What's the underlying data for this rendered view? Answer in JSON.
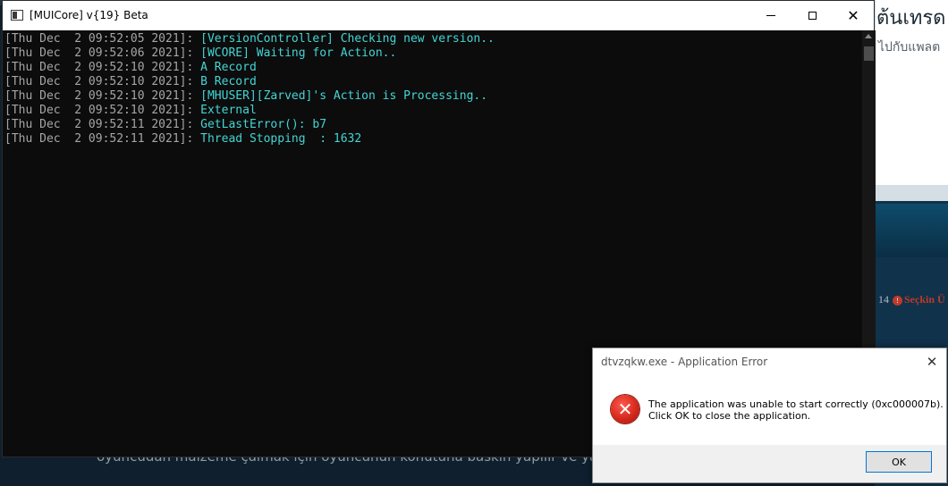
{
  "background": {
    "headline": "ต้นเทรด",
    "subline": "ไปกับแพลต",
    "stat_number": "14",
    "stat_label": "Seçkin Ü",
    "bottom_text": "oyuncudan malzeme çalmak için oyuncunun konutuna baskın yapılır ve yağmal"
  },
  "console": {
    "title": "[MUICore] v{19} Beta",
    "lines": [
      {
        "ts": "[Thu Dec  2 09:52:05 2021]: ",
        "msg": "[VersionController] Checking new version.."
      },
      {
        "ts": "[Thu Dec  2 09:52:06 2021]: ",
        "msg": "[WCORE] Waiting for Action.."
      },
      {
        "ts": "[Thu Dec  2 09:52:10 2021]: ",
        "msg": "A Record"
      },
      {
        "ts": "[Thu Dec  2 09:52:10 2021]: ",
        "msg": "B Record"
      },
      {
        "ts": "[Thu Dec  2 09:52:10 2021]: ",
        "msg": "[MHUSER][Zarved]'s Action is Processing.."
      },
      {
        "ts": "[Thu Dec  2 09:52:10 2021]: ",
        "msg": "External"
      },
      {
        "ts": "[Thu Dec  2 09:52:11 2021]: ",
        "msg": "GetLastError(): b7"
      },
      {
        "ts": "[Thu Dec  2 09:52:11 2021]: ",
        "msg": "Thread Stopping  : 1632"
      }
    ]
  },
  "dialog": {
    "title": "dtvzqkw.exe - Application Error",
    "message_line1": "The application was unable to start correctly (0xc000007b).",
    "message_line2": "Click OK to close the application.",
    "ok_label": "OK"
  },
  "icons": {
    "console_app": "console-window-icon",
    "minimize": "minimize-icon",
    "maximize": "maximize-icon",
    "close": "close-icon",
    "error": "error-icon"
  },
  "colors": {
    "console_bg": "#0c0c0c",
    "timestamp": "#a6a6a6",
    "message": "#45d4d4",
    "error_red": "#d52a1d",
    "ok_border": "#0078d7"
  }
}
